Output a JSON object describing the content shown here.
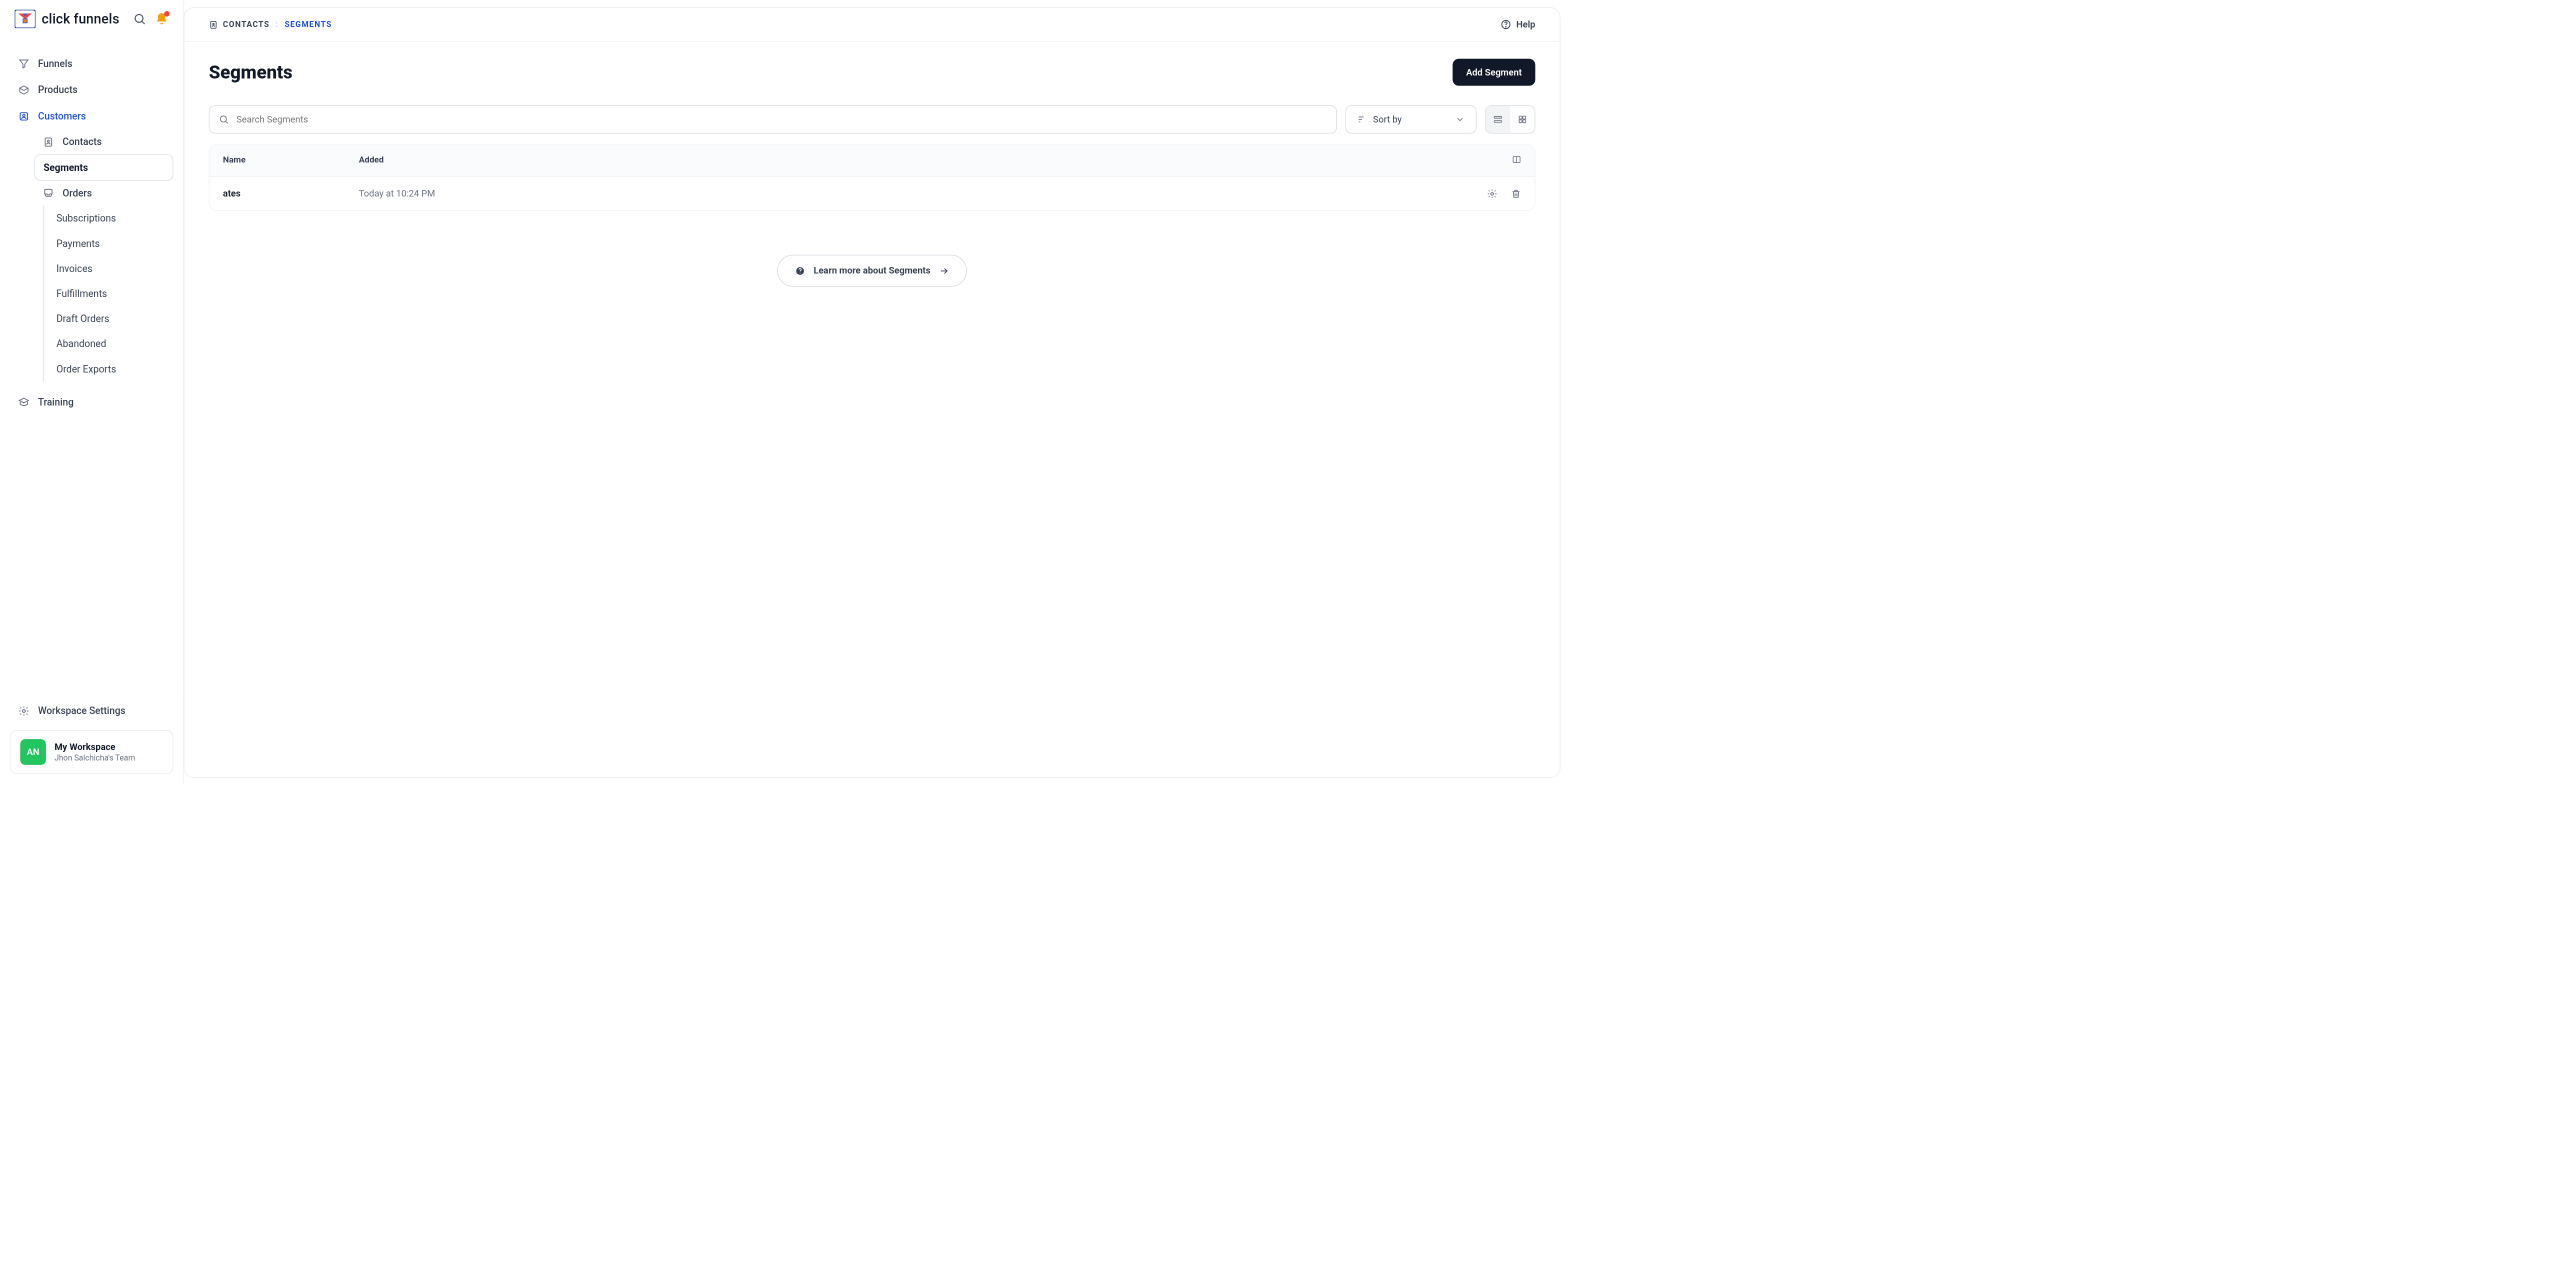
{
  "brand": {
    "name": "click funnels"
  },
  "sidebar": {
    "items": [
      {
        "label": "Funnels"
      },
      {
        "label": "Products"
      },
      {
        "label": "Customers"
      },
      {
        "label": "Training"
      },
      {
        "label": "Workspace Settings"
      }
    ],
    "customers_sub": [
      {
        "label": "Contacts"
      },
      {
        "label": "Segments"
      },
      {
        "label": "Orders"
      }
    ],
    "orders_sub": [
      {
        "label": "Subscriptions"
      },
      {
        "label": "Payments"
      },
      {
        "label": "Invoices"
      },
      {
        "label": "Fulfillments"
      },
      {
        "label": "Draft Orders"
      },
      {
        "label": "Abandoned"
      },
      {
        "label": "Order Exports"
      }
    ]
  },
  "workspace": {
    "initials": "AN",
    "name": "My Workspace",
    "team": "Jhon Salchicha's Team"
  },
  "breadcrumb": {
    "root": "CONTACTS",
    "current": "SEGMENTS"
  },
  "help_label": "Help",
  "page": {
    "title": "Segments",
    "add_button": "Add Segment",
    "search_placeholder": "Search Segments",
    "sort_label": "Sort by"
  },
  "table": {
    "headers": {
      "name": "Name",
      "added": "Added"
    },
    "rows": [
      {
        "name": "ates",
        "added": "Today at 10:24 PM"
      }
    ]
  },
  "learn_more": "Learn more about Segments"
}
